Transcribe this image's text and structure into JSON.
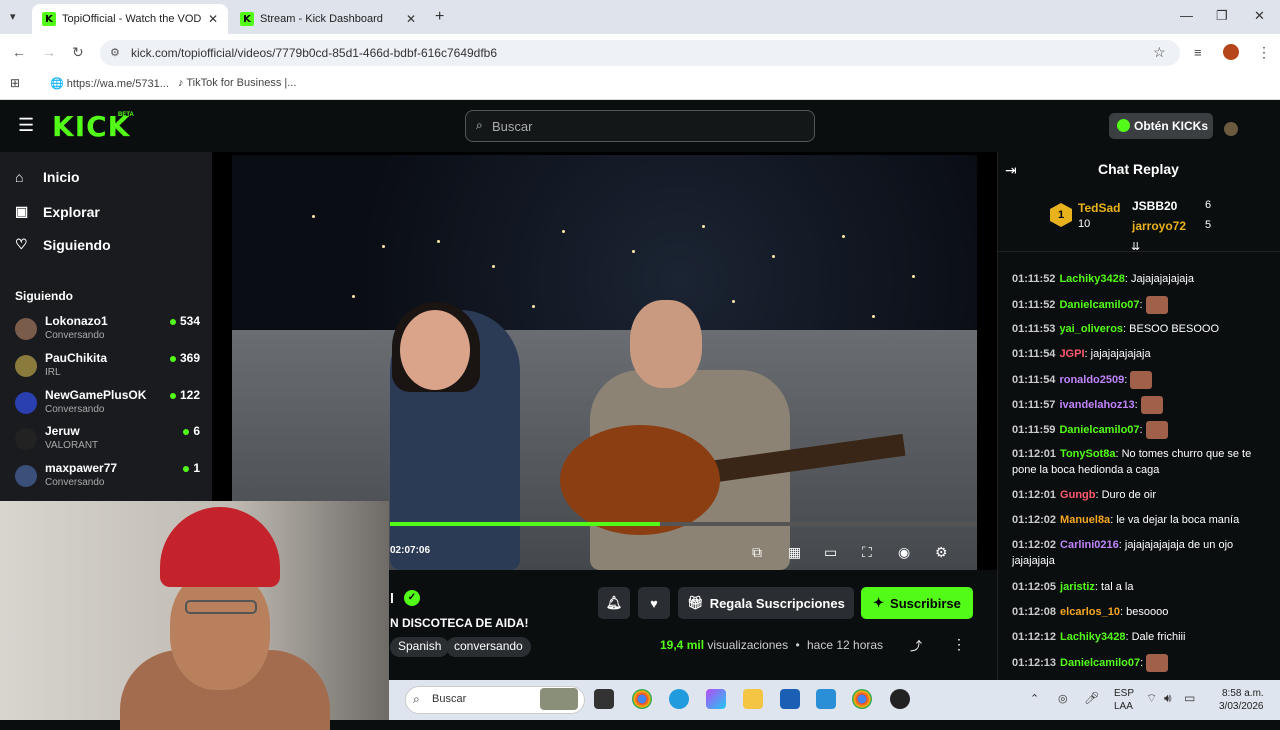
{
  "browser": {
    "tabs": [
      {
        "title": "TopiOfficial - Watch the VOD o",
        "active": true
      },
      {
        "title": "Stream - Kick Dashboard",
        "active": false
      }
    ],
    "url": "kick.com/topiofficial/videos/7779b0cd-85d1-466d-bdbf-616c7649dfb6",
    "bookmarks": [
      "https://wa.me/5731...",
      "TikTok for Business |..."
    ]
  },
  "header": {
    "logo": "KICK",
    "beta": "BETA",
    "search_placeholder": "Buscar",
    "kicks_button": "Obtén KICKs"
  },
  "sidebar": {
    "nav": [
      {
        "label": "Inicio",
        "icon": "home-icon"
      },
      {
        "label": "Explorar",
        "icon": "compass-icon"
      },
      {
        "label": "Siguiendo",
        "icon": "heart-icon"
      }
    ],
    "section_title": "Siguiendo",
    "channels": [
      {
        "name": "Lokonazo1",
        "category": "Conversando",
        "viewers": "534",
        "color": "#7a5c4b"
      },
      {
        "name": "PauChikita",
        "category": "IRL",
        "viewers": "369",
        "color": "#8a7a3c"
      },
      {
        "name": "NewGamePlusOK",
        "category": "Conversando",
        "viewers": "122",
        "color": "#2a3fb0"
      },
      {
        "name": "Jeruw",
        "category": "VALORANT",
        "viewers": "6",
        "color": "#222222"
      },
      {
        "name": "maxpawer77",
        "category": "Conversando",
        "viewers": "1",
        "color": "#3a4f7a"
      }
    ]
  },
  "video": {
    "time": "02:07:06",
    "progress": 0.46,
    "controls": [
      "pip-icon",
      "theater-icon",
      "mini-icon",
      "fullscreen-icon",
      "speed-icon",
      "settings-icon"
    ]
  },
  "info": {
    "channel_fragment": "l",
    "title_fragment": "N DISCOTECA DE AIDA!",
    "tags": [
      "Spanish",
      "conversando"
    ],
    "gift_label": "Regala Suscripciones",
    "subscribe_label": "Suscribirse",
    "views_count": "19,4 mil",
    "views_label": "visualizaciones",
    "separator": "•",
    "ago": "hace 12 horas"
  },
  "chat": {
    "title": "Chat Replay",
    "leaderboard": [
      {
        "rank": "1",
        "name": "TedSad",
        "count": "10",
        "color": "#e8b21c"
      },
      {
        "name": "JSBB20",
        "count": "6",
        "color": "#ffffff"
      },
      {
        "name": "jarroyo72",
        "count": "5",
        "color": "#e8b21c"
      }
    ],
    "messages": [
      {
        "ts": "01:11:52",
        "user": "Lachiky3428",
        "color": "#53fc18",
        "text": "Jajajajajajaja",
        "emote": false
      },
      {
        "ts": "01:11:52",
        "user": "Danielcamilo07",
        "color": "#53fc18",
        "text": "",
        "emote": true
      },
      {
        "ts": "01:11:53",
        "user": "yai_oliveros",
        "color": "#53fc18",
        "text": "BESOO BESOOO",
        "emote": false
      },
      {
        "ts": "01:11:54",
        "user": "JGPI",
        "color": "#ff5a6e",
        "text": "jajajajajajaja",
        "emote": false
      },
      {
        "ts": "01:11:54",
        "user": "ronaldo2509",
        "color": "#c084fc",
        "text": "",
        "emote": true
      },
      {
        "ts": "01:11:57",
        "user": "ivandelahoz13",
        "color": "#c084fc",
        "text": "",
        "emote": true
      },
      {
        "ts": "01:11:59",
        "user": "Danielcamilo07",
        "color": "#53fc18",
        "text": "",
        "emote": true
      },
      {
        "ts": "01:12:01",
        "user": "TonySot8a",
        "color": "#53fc18",
        "text": "No tomes churro que se te pone la boca hedionda a caga",
        "emote": false
      },
      {
        "ts": "01:12:01",
        "user": "Gungb",
        "color": "#ff5a6e",
        "text": "Duro de oir",
        "emote": false
      },
      {
        "ts": "01:12:02",
        "user": "Manuel8a",
        "color": "#f5a623",
        "text": "le va dejar la boca manía",
        "emote": false
      },
      {
        "ts": "01:12:02",
        "user": "Carlini0216",
        "color": "#c084fc",
        "text": "jajajajajajaja de un ojo jajajajaja",
        "emote": false
      },
      {
        "ts": "01:12:05",
        "user": "jaristiz",
        "color": "#53fc18",
        "text": "tal a la",
        "emote": false
      },
      {
        "ts": "01:12:08",
        "user": "elcarlos_10",
        "color": "#f5a623",
        "text": "besoooo",
        "emote": false
      },
      {
        "ts": "01:12:12",
        "user": "Lachiky3428",
        "color": "#53fc18",
        "text": "Dale frichiii",
        "emote": false
      },
      {
        "ts": "01:12:13",
        "user": "Danielcamilo07",
        "color": "#53fc18",
        "text": "",
        "emote": true
      }
    ]
  },
  "taskbar": {
    "search_placeholder": "Buscar",
    "lang": "ESP",
    "lang2": "LAA",
    "time": "8:58 a.m.",
    "date": "3/03/2026"
  }
}
